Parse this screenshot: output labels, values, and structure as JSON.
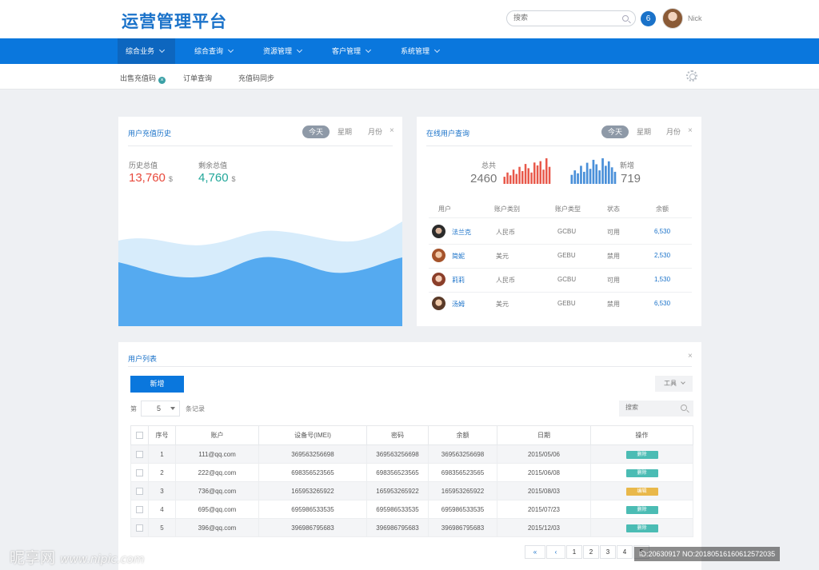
{
  "header": {
    "logo": "运营管理平台",
    "search_placeholder": "搜索",
    "notif_count": "6",
    "username": "Nick"
  },
  "nav": [
    "综合业务",
    "综合查询",
    "资源管理",
    "客户管理",
    "系统管理"
  ],
  "subnav": [
    "出售充值码",
    "订单查询",
    "充值码同步"
  ],
  "recharge": {
    "title": "用户充值历史",
    "tabs": [
      "今天",
      "星期",
      "月份"
    ],
    "close": "×",
    "history_label": "历史总值",
    "history_value": "13,760",
    "remain_label": "剩余总值",
    "remain_value": "4,760",
    "currency": "$",
    "colors": {
      "history": "#e8493c",
      "remain": "#22a79a",
      "wave_light": "#d7ecfb",
      "wave_dark": "#55aaf0"
    }
  },
  "online": {
    "title": "在线用户查询",
    "tabs": [
      "今天",
      "星期",
      "月份"
    ],
    "close": "×",
    "total_label": "总共",
    "total_value": "2460",
    "new_label": "新增",
    "new_value": "719",
    "spark_total": [
      5,
      8,
      6,
      10,
      7,
      12,
      9,
      14,
      11,
      8,
      15,
      13,
      16,
      10,
      18,
      12
    ],
    "spark_new": [
      6,
      9,
      7,
      12,
      8,
      14,
      10,
      16,
      13,
      9,
      17,
      12,
      15,
      11,
      8
    ],
    "columns": [
      "用户",
      "账户类别",
      "账户类型",
      "状态",
      "余额"
    ],
    "rows": [
      [
        "法兰克",
        "人民币",
        "GCBU",
        "可用",
        "6,530"
      ],
      [
        "简妮",
        "美元",
        "GEBU",
        "禁用",
        "2,530"
      ],
      [
        "莉莉",
        "人民币",
        "GCBU",
        "可用",
        "1,530"
      ],
      [
        "汤姆",
        "美元",
        "GEBU",
        "禁用",
        "6,530"
      ]
    ]
  },
  "userlist": {
    "title": "用户列表",
    "close": "×",
    "add_button": "新增",
    "tools": "工具",
    "page_prefix": "第",
    "page_size": "5",
    "page_suffix": "条记录",
    "search_placeholder": "搜索",
    "columns": [
      "序号",
      "账户",
      "设备号(IMEI)",
      "密码",
      "余额",
      "日期",
      "操作"
    ],
    "rows": [
      [
        "1",
        "111@qq.com",
        "369563256698",
        "369563256698",
        "369563256698",
        "2015/05/06",
        "删除"
      ],
      [
        "2",
        "222@qq.com",
        "698356523565",
        "698356523565",
        "698356523565",
        "2015/06/08",
        "删除"
      ],
      [
        "3",
        "736@qq.com",
        "165953265922",
        "165953265922",
        "165953265922",
        "2015/08/03",
        "编辑"
      ],
      [
        "4",
        "695@qq.com",
        "695986533535",
        "695986533535",
        "695986533535",
        "2015/07/23",
        "删除"
      ],
      [
        "5",
        "396@qq.com",
        "396986795683",
        "396986795683",
        "396986795683",
        "2015/12/03",
        "删除"
      ]
    ],
    "action_colors": {
      "删除": "#4bbcb4",
      "编辑": "#e9b84a"
    },
    "pagination": [
      "«",
      "‹",
      "1",
      "2",
      "3",
      "4",
      "5"
    ]
  },
  "watermark": {
    "brand": "昵享网",
    "url": "www.nipic.com",
    "id": "ID:20630917 NO:20180516160612572035"
  }
}
